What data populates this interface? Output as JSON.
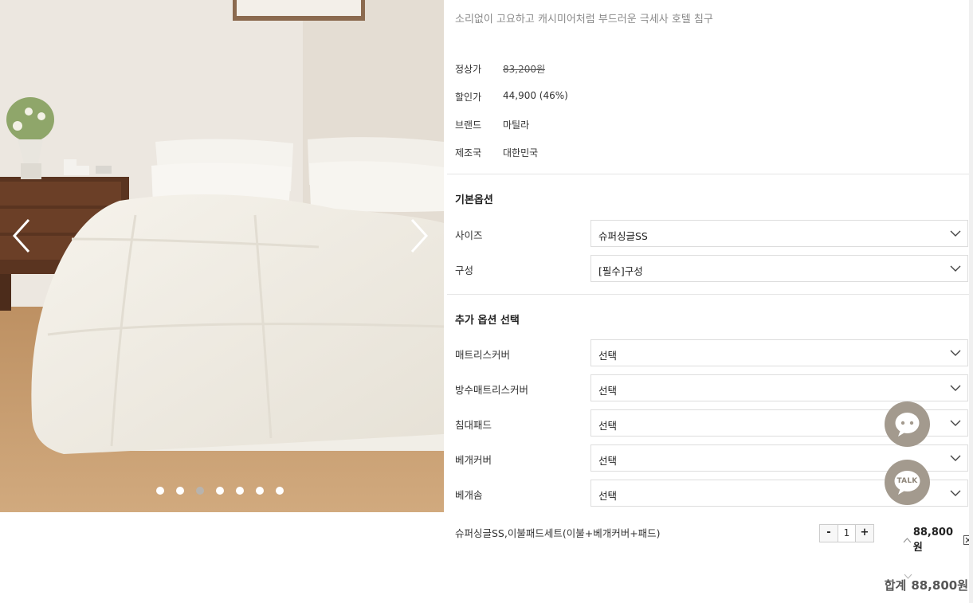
{
  "gallery": {
    "prev_label": "previous image",
    "next_label": "next image",
    "dots_count": 7,
    "active_dot": 2
  },
  "product": {
    "subtitle": "소리없이 고요하고 캐시미어처럼 부드러운 극세사 호텔 침구",
    "meta": [
      {
        "label": "정상가",
        "value": "83,200원"
      },
      {
        "label": "할인가",
        "value": "44,900 (46%)"
      },
      {
        "label": "브랜드",
        "value": "마틸라"
      },
      {
        "label": "제조국",
        "value": "대한민국"
      }
    ]
  },
  "basic_options": {
    "title": "기본옵션",
    "rows": [
      {
        "label": "사이즈",
        "value": "슈퍼싱글SS"
      },
      {
        "label": "구성",
        "value": "[필수]구성"
      }
    ]
  },
  "extra_options": {
    "title": "추가 옵션 선택",
    "rows": [
      {
        "label": "매트리스커버",
        "value": "선택"
      },
      {
        "label": "방수매트리스커버",
        "value": "선택"
      },
      {
        "label": "침대패드",
        "value": "선택"
      },
      {
        "label": "베개커버",
        "value": "선택"
      },
      {
        "label": "베개솜",
        "value": "선택"
      }
    ]
  },
  "selected_item": {
    "name": "슈퍼싱글SS,이불패드세트(이불+베개커버+패드)",
    "minus": "-",
    "quantity": "1",
    "plus": "+",
    "price": "88,800원"
  },
  "total": {
    "label": "합계",
    "value": "88,800원"
  },
  "floating": {
    "talk_label": "TALK"
  },
  "colors": {
    "fab": "#a39a8e",
    "border": "#dddddd"
  }
}
